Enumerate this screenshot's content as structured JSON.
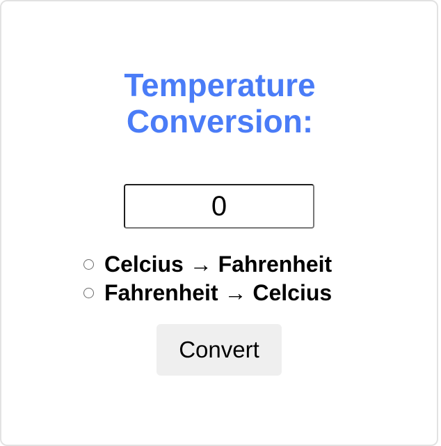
{
  "title": {
    "line1": "Temperature",
    "line2": "Conversion:"
  },
  "input": {
    "value": "0"
  },
  "options": [
    {
      "label": "Celcius → Fahrenheit",
      "selected": false
    },
    {
      "label": "Fahrenheit → Celcius",
      "selected": false
    }
  ],
  "convert_button": {
    "label": "Convert"
  },
  "colors": {
    "title": "#4a7cf7",
    "button_bg": "#efefef"
  }
}
